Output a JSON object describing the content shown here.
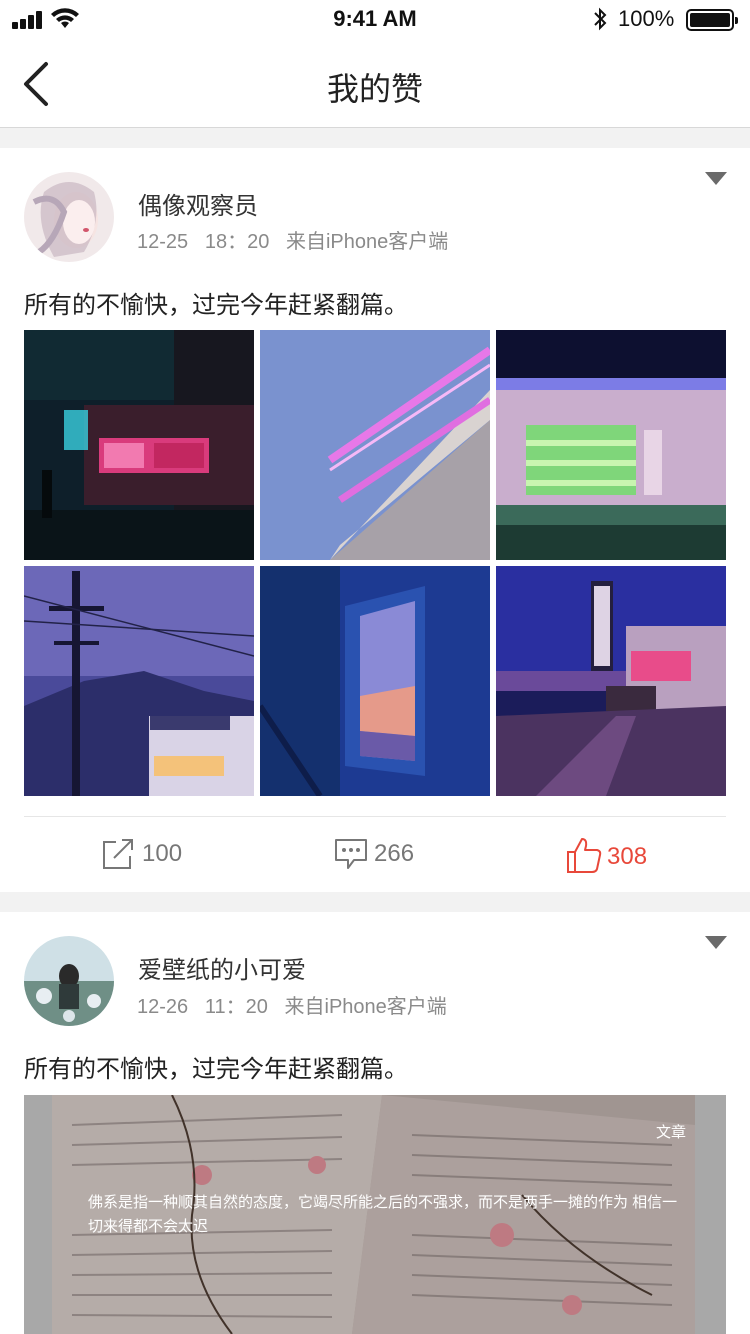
{
  "status_bar": {
    "time": "9:41 AM",
    "battery": "100%"
  },
  "nav": {
    "title": "我的赞"
  },
  "posts": [
    {
      "username": "偶像观察员",
      "meta": "12-25   18：20   来自iPhone客户端",
      "text": "所有的不愉快，过完今年赶紧翻篇。",
      "actions": {
        "share": "100",
        "comment": "266",
        "like": "308"
      }
    },
    {
      "username": "爱壁纸的小可爱",
      "meta": "12-26   11：20   来自iPhone客户端",
      "text": "所有的不愉快，过完今年赶紧翻篇。",
      "article": {
        "tag": "文章",
        "quote": "佛系是指一种顺其自然的态度，它竭尽所能之后的不强求，而不是两手一摊的作为 相信一切来得都不会太迟"
      }
    }
  ],
  "colors": {
    "like_active": "#e8483a",
    "meta_gray": "#8a8a8a"
  }
}
